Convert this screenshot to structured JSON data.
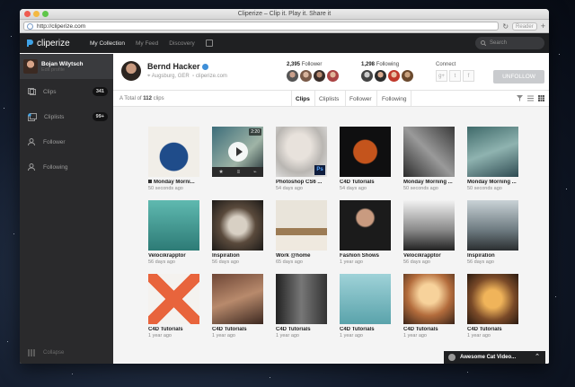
{
  "window": {
    "title": "Cliperize – Clip it. Play it. Share it",
    "url": "http://cliperize.com",
    "reader": "Reader"
  },
  "app": {
    "logo": "cliperize",
    "nav": [
      "My Collection",
      "My Feed",
      "Discovery"
    ],
    "search_placeholder": "Search"
  },
  "sidebar": {
    "user_name": "Bojan Wilytsch",
    "user_sub": "Edit profile",
    "items": [
      {
        "label": "Clips",
        "icon": "clips-icon",
        "count": "341"
      },
      {
        "label": "Cliplists",
        "icon": "cliplists-icon",
        "count": "99+"
      },
      {
        "label": "Follower",
        "icon": "follower-icon",
        "count": ""
      },
      {
        "label": "Following",
        "icon": "following-icon",
        "count": ""
      }
    ],
    "collapse": "Collapse"
  },
  "profile": {
    "name": "Bernd Hacker",
    "location": "Augsburg, GER",
    "website": "cliperize.com",
    "follower_count": "2,395",
    "follower_label": "Follower",
    "following_count": "1,298",
    "following_label": "Following",
    "connect_label": "Connect",
    "social": [
      "g+",
      "t",
      "f"
    ],
    "unfollow": "UNFOLLOW"
  },
  "tabs": {
    "total_prefix": "A Total of",
    "total_count": "112",
    "total_suffix": "clips",
    "items": [
      "Clips",
      "Cliplists",
      "Follower",
      "Following"
    ]
  },
  "clips": [
    {
      "title": "Monday Morni...",
      "meta": "50 seconds ago"
    },
    {
      "title": "",
      "meta": "",
      "duration": "2:20"
    },
    {
      "title": "Photoshop CS6 ...",
      "meta": "54 days ago"
    },
    {
      "title": "C4D Tutorials",
      "meta": "54 days ago"
    },
    {
      "title": "Monday Morning ...",
      "meta": "50 seconds ago"
    },
    {
      "title": "Monday Morning ...",
      "meta": "50 seconds ago"
    },
    {
      "title": "Velocikrapptor",
      "meta": "56 days ago"
    },
    {
      "title": "Inspiration",
      "meta": "56 days ago"
    },
    {
      "title": "Work @home",
      "meta": "65 days ago"
    },
    {
      "title": "Fashion Shows",
      "meta": "1 year ago"
    },
    {
      "title": "Velocikrapptor",
      "meta": "56 days ago"
    },
    {
      "title": "Inspiration",
      "meta": "56 days ago"
    },
    {
      "title": "C4D Tutorials",
      "meta": "1 year ago"
    },
    {
      "title": "C4D Tutorials",
      "meta": "1 year ago"
    },
    {
      "title": "C4D Tutorials",
      "meta": "1 year ago"
    },
    {
      "title": "C4D Tutorials",
      "meta": "1 year ago"
    },
    {
      "title": "C4D Tutorials",
      "meta": "1 year ago"
    },
    {
      "title": "C4D Tutorials",
      "meta": "1 year ago"
    }
  ],
  "popup": {
    "title": "Awesome Cat Video..."
  }
}
